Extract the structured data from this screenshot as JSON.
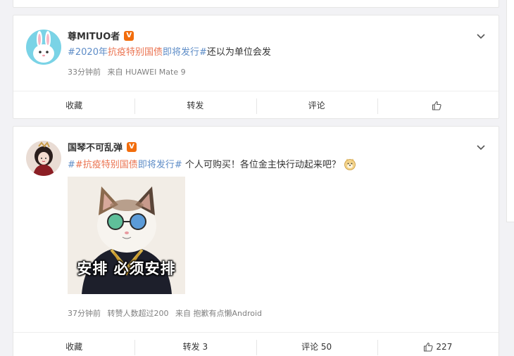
{
  "posts": [
    {
      "author": "尊MITUO者",
      "verified_badge": "V",
      "content": {
        "topic_start": "#2020年",
        "topic_red": "抗疫特别国债",
        "topic_blue": "即将发行#",
        "text": "还以为单位会发"
      },
      "time": "33分钟前",
      "source": "来自 HUAWEI Mate 9",
      "actions": {
        "favorite": "收藏",
        "repost": "转发",
        "comment": "评论",
        "like": ""
      }
    },
    {
      "author": "国琴不可乱弹",
      "verified_badge": "V",
      "content": {
        "topic_red_start": "#抗疫特别国债",
        "topic_blue": "即将发行#",
        "text": " 个人可购买！各位金主快行动起来吧？"
      },
      "image_caption": "安排 必须安排",
      "time": "37分钟前",
      "reposts_note": "转赞人数超过200",
      "source": "来自 抱歉有点懒Android",
      "actions": {
        "favorite": "收藏",
        "repost": "转发 3",
        "comment": "评论 50",
        "like": "227"
      }
    }
  ],
  "icons": {
    "chevron": "chevron-down-icon",
    "like": "thumbs-up-icon",
    "emoji": "doge-emoji-icon"
  },
  "colors": {
    "topic_red": "#eb7350",
    "topic_blue": "#5d8cc7",
    "verified": "#f26d0c"
  }
}
